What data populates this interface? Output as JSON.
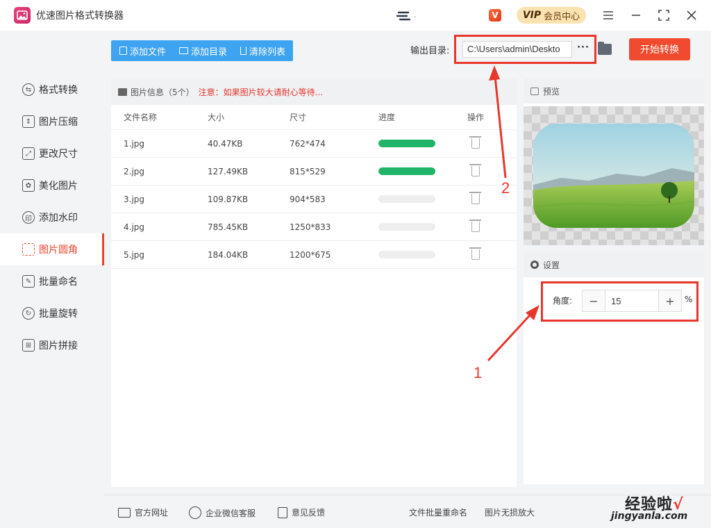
{
  "app": {
    "title": "优速图片格式转换器"
  },
  "header": {
    "vip_label": "会员中心",
    "vip_badge": "VIP"
  },
  "sidebar": {
    "items": [
      {
        "label": "格式转换",
        "icon": "format-convert-icon",
        "active": false
      },
      {
        "label": "图片压缩",
        "icon": "compress-icon",
        "active": false
      },
      {
        "label": "更改尺寸",
        "icon": "resize-icon",
        "active": false
      },
      {
        "label": "美化图片",
        "icon": "beautify-icon",
        "active": false
      },
      {
        "label": "添加水印",
        "icon": "watermark-icon",
        "active": false
      },
      {
        "label": "图片圆角",
        "icon": "round-corner-icon",
        "active": true
      },
      {
        "label": "批量命名",
        "icon": "rename-icon",
        "active": false
      },
      {
        "label": "批量旋转",
        "icon": "rotate-icon",
        "active": false
      },
      {
        "label": "图片拼接",
        "icon": "stitch-icon",
        "active": false
      }
    ]
  },
  "toolbar": {
    "add_file": "添加文件",
    "add_folder": "添加目录",
    "clear_list": "清除列表",
    "output_label": "输出目录:",
    "output_path": "C:\\Users\\admin\\Deskto",
    "more": "···",
    "start": "开始转换"
  },
  "file_panel": {
    "title": "图片信息（5个）",
    "warning": "注意：如果图片较大请耐心等待...",
    "columns": [
      "文件名称",
      "大小",
      "尺寸",
      "进度",
      "操作"
    ],
    "rows": [
      {
        "name": "1.jpg",
        "size": "40.47KB",
        "dims": "762*474",
        "progress": 1.0
      },
      {
        "name": "2.jpg",
        "size": "127.49KB",
        "dims": "815*529",
        "progress": 1.0
      },
      {
        "name": "3.jpg",
        "size": "109.87KB",
        "dims": "904*583",
        "progress": 0
      },
      {
        "name": "4.jpg",
        "size": "785.45KB",
        "dims": "1250*833",
        "progress": 0
      },
      {
        "name": "5.jpg",
        "size": "184.04KB",
        "dims": "1200*675",
        "progress": 0
      }
    ]
  },
  "preview": {
    "title": "预览"
  },
  "settings": {
    "title": "设置",
    "angle_label": "角度:",
    "angle_value": "15",
    "minus": "−",
    "plus": "+",
    "unit": "%"
  },
  "footer": {
    "website": "官方网址",
    "wechat": "企业微信客服",
    "feedback": "意见反馈",
    "link1": "文件批量重命名",
    "link2": "图片无损放大"
  },
  "annotations": {
    "label1": "1",
    "label2": "2"
  },
  "watermark": {
    "text": "经验啦",
    "url": "jingyanla.com",
    "check": "√"
  },
  "colors": {
    "accent": "#e8452f",
    "toolbar_blue": "#3ea3f0",
    "start_btn": "#f04b2e",
    "progress_green": "#1fb468",
    "annotation_red": "#e8362b"
  }
}
